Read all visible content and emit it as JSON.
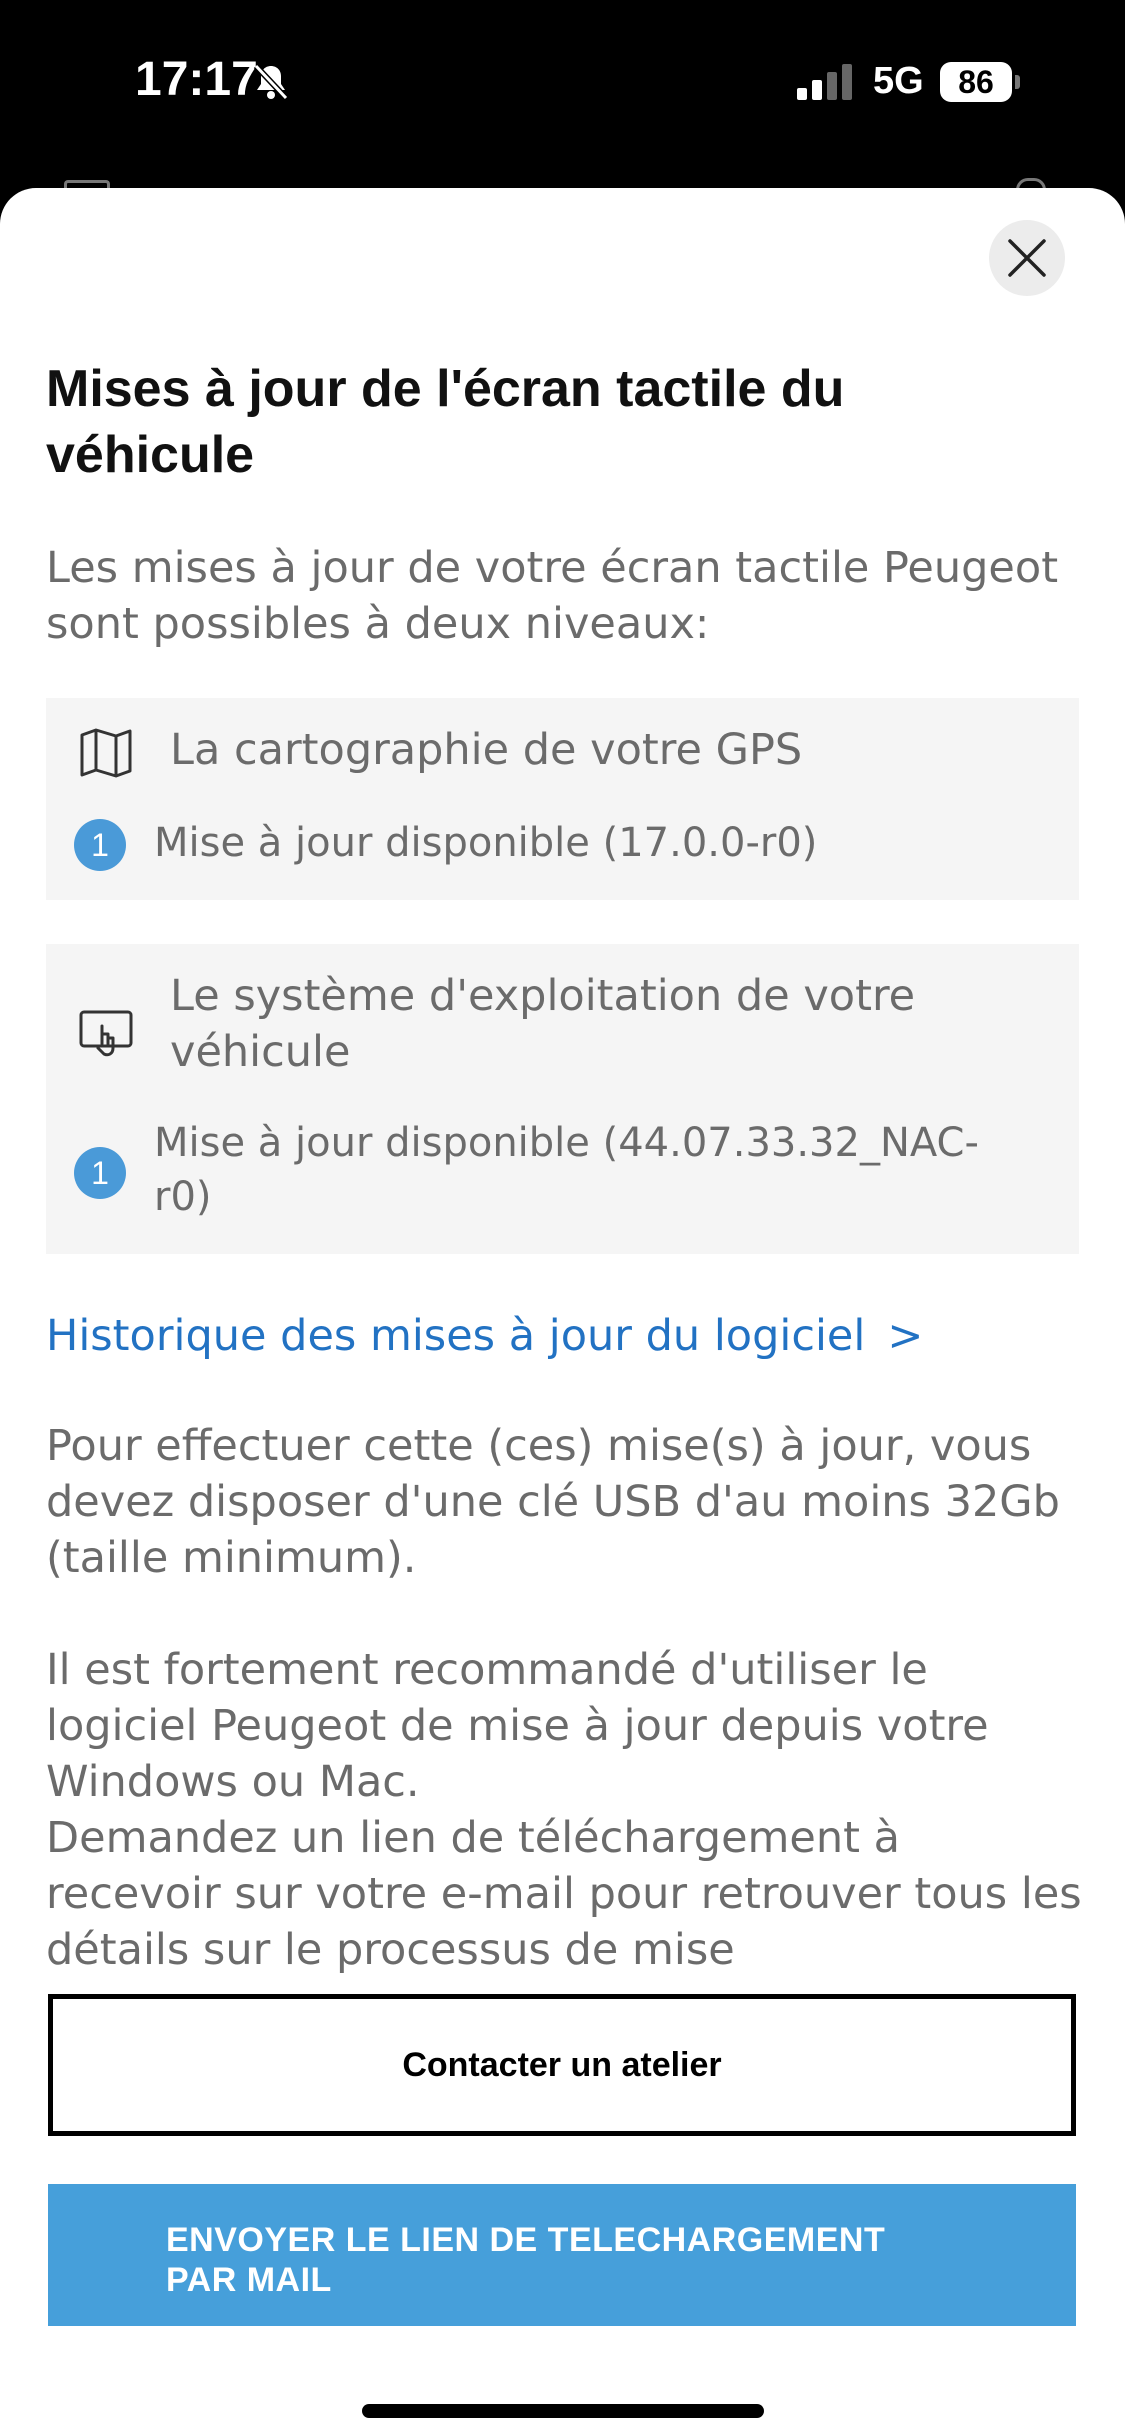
{
  "status_bar": {
    "time": "17:17",
    "network": "5G",
    "battery": "86",
    "icons": [
      "bell-slash-icon",
      "cellular-signal-icon",
      "battery-icon"
    ]
  },
  "sheet": {
    "title": "Mises à jour de l'écran tactile du véhicule",
    "intro": "Les mises à jour de votre écran tactile Peugeot sont possibles à deux niveaux:",
    "cards": [
      {
        "icon": "map-icon",
        "title": "La cartographie de votre GPS",
        "badge": "1",
        "update": "Mise à jour disponible (17.0.0-r0)"
      },
      {
        "icon": "touchscreen-icon",
        "title": "Le système d'exploitation de votre véhicule",
        "badge": "1",
        "update": "Mise à jour disponible (44.07.33.32_NAC-r0)"
      }
    ],
    "history_link": "Historique des mises à jour du logiciel",
    "paragraph_1": "Pour effectuer cette (ces) mise(s) à jour, vous devez disposer d'une clé USB d'au moins 32Gb (taille minimum).",
    "paragraph_2": "Il est fortement recommandé d'utiliser le logiciel Peugeot  de mise à jour depuis votre Windows ou Mac.",
    "paragraph_3": "Demandez un lien de téléchargement à recevoir sur votre e-mail pour retrouver tous les détails sur le processus de mise",
    "contact_button": "Contacter un atelier",
    "send_button_line1": "ENVOYER LE LIEN DE TELECHARGEMENT",
    "send_button_line2": "PAR MAIL"
  },
  "colors": {
    "accent_blue": "#469fda",
    "link_blue": "#2272c3",
    "badge_blue": "#4a9ad8",
    "text_gray": "#6b6b6b",
    "card_bg": "#f5f5f5"
  }
}
